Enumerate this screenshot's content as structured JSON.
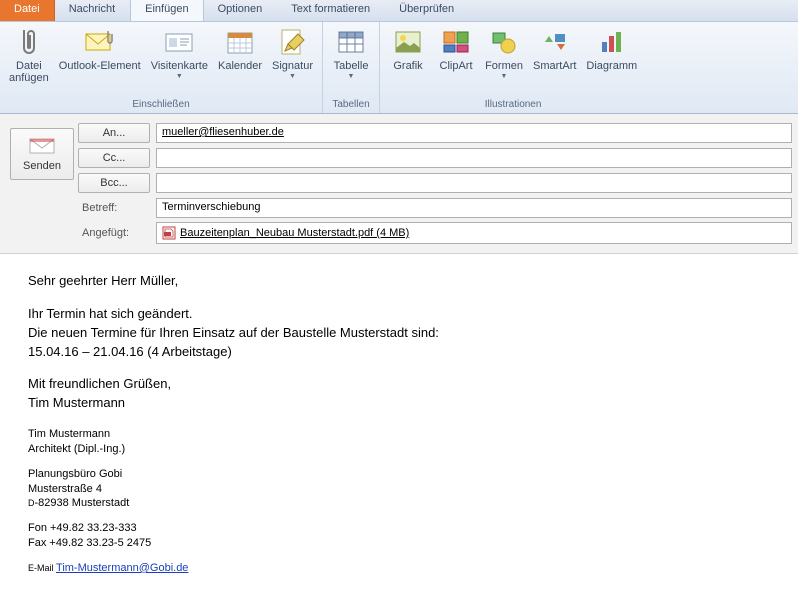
{
  "tabs": {
    "file": "Datei",
    "message": "Nachricht",
    "insert": "Einfügen",
    "options": "Optionen",
    "format": "Text formatieren",
    "review": "Überprüfen"
  },
  "ribbon": {
    "include_label": "Einschließen",
    "tables_label": "Tabellen",
    "illustrations_label": "Illustrationen",
    "attach_file": "Datei\nanfügen",
    "outlook_item": "Outlook-Element",
    "business_card": "Visitenkarte",
    "calendar": "Kalender",
    "signature": "Signatur",
    "table": "Tabelle",
    "graphic": "Grafik",
    "clipart": "ClipArt",
    "shapes": "Formen",
    "smartart": "SmartArt",
    "diagram": "Diagramm"
  },
  "compose": {
    "send": "Senden",
    "to_btn": "An...",
    "cc_btn": "Cc...",
    "bcc_btn": "Bcc...",
    "subject_label": "Betreff:",
    "attached_label": "Angefügt:",
    "to_value": "mueller@fliesenhuber.de",
    "cc_value": "",
    "bcc_value": "",
    "subject_value": "Terminverschiebung",
    "attachment_name": "Bauzeitenplan_Neubau Musterstadt.pdf (4 MB)"
  },
  "body": {
    "greeting": "Sehr geehrter Herr Müller,",
    "p1": "Ihr Termin hat sich geändert.",
    "p2": "Die neuen Termine für Ihren Einsatz auf der Baustelle Musterstadt sind:",
    "p3": "15.04.16 – 21.04.16 (4 Arbeitstage)",
    "closing1": "Mit freundlichen Grüßen,",
    "closing2": "Tim Mustermann",
    "sig_name": "Tim Mustermann",
    "sig_title": "Architekt (Dipl.-Ing.)",
    "sig_company": "Planungsbüro Gobi",
    "sig_street": "Musterstraße 4",
    "sig_city": "-82938 Musterstadt",
    "sig_city_prefix": "D",
    "sig_phone": "Fon +49.82 33.23-333",
    "sig_fax": "Fax +49.82 33.23-5 2475",
    "sig_email_label": "E-Mail ",
    "sig_email": "Tim-Mustermann@Gobi.de"
  }
}
